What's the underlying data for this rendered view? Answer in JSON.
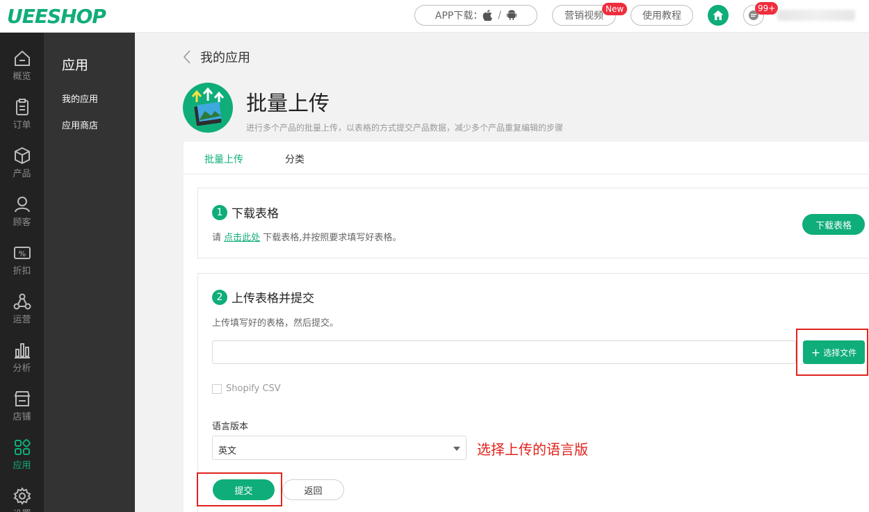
{
  "header": {
    "logo": "UEESHOP",
    "app_download": "APP下载：",
    "app_sep": "/",
    "marketing_video": "营销视频",
    "new_badge": "New",
    "tutorial": "使用教程",
    "msg_count": "99+"
  },
  "rail": [
    {
      "label": "概览",
      "icon": "overview-icon"
    },
    {
      "label": "订单",
      "icon": "order-icon"
    },
    {
      "label": "产品",
      "icon": "product-icon"
    },
    {
      "label": "顾客",
      "icon": "customer-icon"
    },
    {
      "label": "折扣",
      "icon": "discount-icon"
    },
    {
      "label": "运营",
      "icon": "operation-icon"
    },
    {
      "label": "分析",
      "icon": "analytics-icon"
    },
    {
      "label": "店铺",
      "icon": "store-icon"
    },
    {
      "label": "应用",
      "icon": "apps-icon"
    },
    {
      "label": "设置",
      "icon": "settings-icon"
    }
  ],
  "subnav": {
    "title": "应用",
    "items": [
      "我的应用",
      "应用商店"
    ]
  },
  "page": {
    "back_title": "我的应用",
    "app_title": "批量上传",
    "app_desc": "进行多个产品的批量上传，以表格的方式提交产品数据，减少多个产品重复编辑的步骤"
  },
  "tabs": [
    "批量上传",
    "分类"
  ],
  "step1": {
    "num": "1",
    "title": "下载表格",
    "desc_prefix": "请 ",
    "desc_link": "点击此处",
    "desc_suffix": " 下载表格,并按照要求填写好表格。",
    "button": "下载表格"
  },
  "step2": {
    "num": "2",
    "title": "上传表格并提交",
    "desc": "上传填写好的表格，然后提交。",
    "file_placeholder": "",
    "file_button": "选择文件",
    "file_plus": "+",
    "checkbox_label": "Shopify CSV",
    "lang_label": "语言版本",
    "lang_value": "英文",
    "annotation": "选择上传的语言版",
    "submit": "提交",
    "back": "返回"
  },
  "colors": {
    "accent": "#0fad7a",
    "annotation": "#e0231c",
    "badge": "#f02d3c"
  }
}
